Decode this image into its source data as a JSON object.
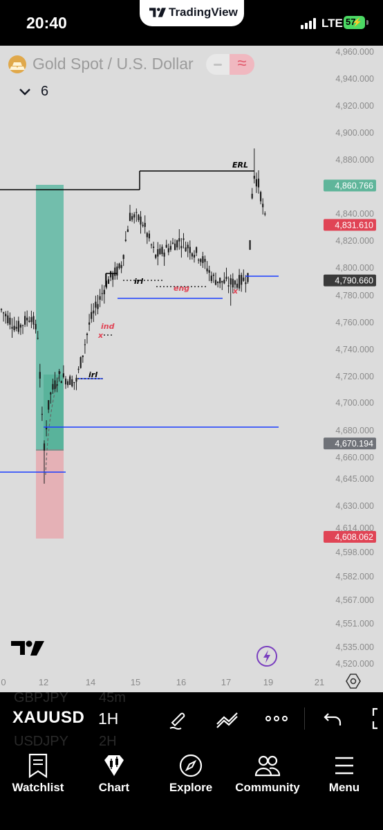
{
  "status_bar": {
    "time": "20:40",
    "app_pill": "TradingView",
    "network": "LTE",
    "battery": "57"
  },
  "chart_header": {
    "symbol_title": "Gold Spot / U.S. Dollar",
    "indicators_count": "6",
    "symbol_icon": "gold-bars-icon"
  },
  "colors": {
    "background": "#dcdcdc",
    "candle": "#1c1c1c",
    "zone_top": "#5fb8a3",
    "zone_bottom": "#e6a9af",
    "level_line": "#1a3cff",
    "label_red": "#e04455",
    "label_green": "#5fb59a",
    "label_gray": "#5c5c5c",
    "label_dark": "#3a3a3a",
    "label_slate": "#6f7278"
  },
  "chart_data": {
    "type": "candlestick",
    "series_description": "XAUUSD 1H",
    "y_ticks": [
      "4,960.000",
      "4,940.000",
      "4,920.000",
      "4,900.000",
      "4,880.000",
      "4,840.000",
      "4,820.000",
      "4,800.000",
      "4,780.000",
      "4,760.000",
      "4,740.000",
      "4,720.000",
      "4,700.000",
      "4,680.000",
      "4,660.000",
      "4,645.000",
      "4,630.000",
      "4,614.000",
      "4,598.000",
      "4,582.000",
      "4,567.000",
      "4,551.000",
      "4,535.000",
      "4,520.000"
    ],
    "price_labels": [
      {
        "text": "4,860.766",
        "color": "#5fb59a"
      },
      {
        "text": "4,831.610",
        "color": "#e04455"
      },
      {
        "text": "4,790.660",
        "color": "#3a3a3a"
      },
      {
        "text": "4,670.194",
        "color": "#6f7278"
      },
      {
        "text": "4,608.062",
        "color": "#e04455"
      }
    ],
    "x_ticks": [
      "0",
      "12",
      "14",
      "15",
      "16",
      "17",
      "19",
      "21"
    ],
    "annotations": [
      {
        "text": "ERL",
        "color": "#000000"
      },
      {
        "text": "irl",
        "color": "#000000"
      },
      {
        "text": "eng",
        "color": "#e04455"
      },
      {
        "text": "x",
        "color": "#e04455"
      },
      {
        "text": "ind",
        "color": "#e04455"
      },
      {
        "text": "x",
        "color": "#e04455"
      },
      {
        "text": "irl",
        "color": "#000000"
      }
    ]
  },
  "toolbar": {
    "symbol": "XAUUSD",
    "interval": "1H",
    "ghost_rows": [
      "GBPJPY",
      "45m",
      "USDJPY",
      "2H"
    ]
  },
  "tabs": [
    {
      "label": "Watchlist",
      "icon": "watchlist-icon"
    },
    {
      "label": "Chart",
      "icon": "chart-icon"
    },
    {
      "label": "Explore",
      "icon": "compass-icon"
    },
    {
      "label": "Community",
      "icon": "community-icon"
    },
    {
      "label": "Menu",
      "icon": "menu-icon"
    }
  ]
}
